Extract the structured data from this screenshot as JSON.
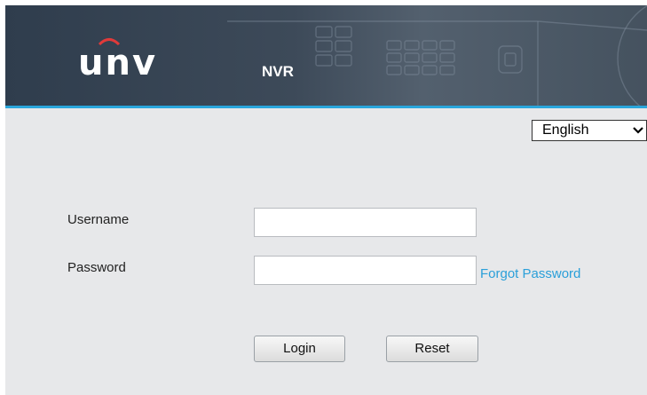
{
  "header": {
    "logo_text": "unv",
    "product": "NVR"
  },
  "language": {
    "selected": "English"
  },
  "form": {
    "username_label": "Username",
    "username_value": "",
    "password_label": "Password",
    "password_value": "",
    "forgot_password": "Forgot Password",
    "login_label": "Login",
    "reset_label": "Reset"
  },
  "colors": {
    "accent": "#2aa6dc",
    "header": "#3d4a59",
    "background": "#e7e8ea"
  }
}
